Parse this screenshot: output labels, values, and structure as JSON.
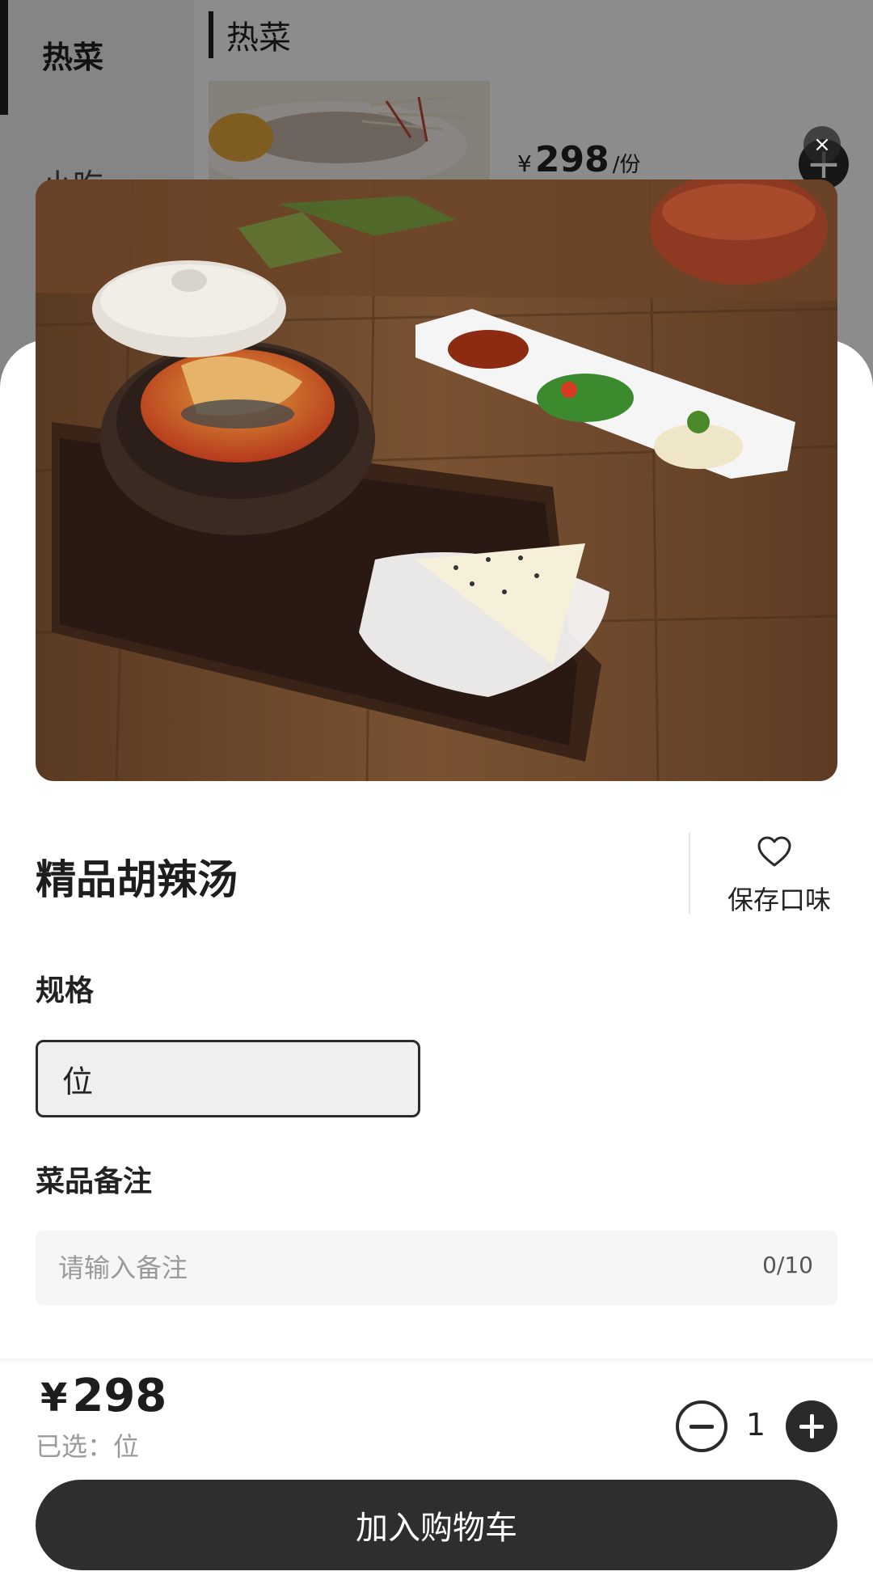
{
  "background_menu": {
    "categories": [
      "热菜",
      "小吃"
    ],
    "section_title": "热菜",
    "item": {
      "currency": "¥",
      "price": "298",
      "unit": "/份"
    },
    "add_symbol": "+"
  },
  "sheet": {
    "close_symbol": "×",
    "dish": {
      "name": "精品胡辣汤"
    },
    "favorite": {
      "label": "保存口味",
      "icon": "heart-outline-icon"
    },
    "spec": {
      "label": "规格",
      "options": [
        "位"
      ],
      "selected": "位"
    },
    "note": {
      "label": "菜品备注",
      "placeholder": "请输入备注",
      "count": "0/10"
    },
    "footer": {
      "currency": "¥",
      "price": "298",
      "selected_text": "已选：位",
      "quantity": "1",
      "add_to_cart": "加入购物车"
    }
  },
  "colors": {
    "primary_dark": "#2e2e2e",
    "muted_text": "#9a9a9a",
    "input_bg": "#f6f6f6"
  }
}
